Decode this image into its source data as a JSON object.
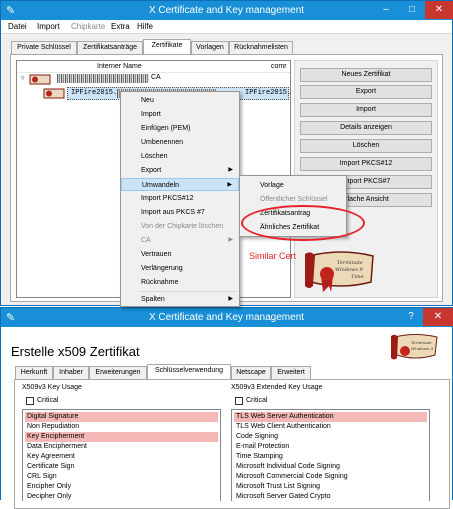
{
  "top_window": {
    "title": "X Certificate and Key management",
    "controls": [
      "–",
      "□",
      "✕"
    ],
    "menu": [
      "Datei",
      "Import",
      "Chipkarte",
      "Extra",
      "Hilfe"
    ],
    "tabs": [
      "Private Schlüssel",
      "Zertifikatsanträge",
      "Zertifikate",
      "Vorlagen",
      "Rücknahmelisten"
    ],
    "columns": [
      "Interner Name",
      "comr"
    ],
    "rows": [
      {
        "name": "CA",
        "extra": ""
      },
      {
        "name": "IPFire2015.",
        "extra": "IPFire2015."
      }
    ],
    "buttons": [
      "Neues Zertifikat",
      "Export",
      "Import",
      "Details anzeigen",
      "Löschen",
      "Import PKCS#12",
      "Import PKCS#7",
      "Flache Ansicht"
    ],
    "context_menu": [
      "Neu",
      "Import",
      "Einfügen (PEM)",
      "Umbenennen",
      "Löschen",
      "Export",
      "Umwandeln",
      "Import PKCS#12",
      "Import aus PKCS #7",
      "Von der Chipkarte löschen",
      "CA",
      "Vertrauen",
      "Verlängerung",
      "Rücknahme",
      "Spalten"
    ],
    "submenu": [
      "Vorlage",
      "Öffentlicher Schlüssel",
      "Zertifikatsantrag",
      "Ähnliches Zertifikat"
    ],
    "annotation": "Similar Cert",
    "logo_text": "Terminate Windows 9 Time"
  },
  "bottom_window": {
    "title": "X Certificate and Key management",
    "controls": [
      "?",
      "✕"
    ],
    "heading": "Erstelle x509 Zertifikat",
    "tabs": [
      "Herkunft",
      "Inhaber",
      "Erweiterungen",
      "Schlüsselverwendung",
      "Netscape",
      "Erweitert"
    ],
    "key_usage": {
      "title": "X509v3 Key Usage",
      "critical_label": "Critical",
      "items": [
        {
          "label": "Digital Signature",
          "selected": true
        },
        {
          "label": "Non Repudiation",
          "selected": false
        },
        {
          "label": "Key Encipherment",
          "selected": true
        },
        {
          "label": "Data Encipherment",
          "selected": false
        },
        {
          "label": "Key Agreement",
          "selected": false
        },
        {
          "label": "Certificate Sign",
          "selected": false
        },
        {
          "label": "CRL Sign",
          "selected": false
        },
        {
          "label": "Encipher Only",
          "selected": false
        },
        {
          "label": "Decipher Only",
          "selected": false
        }
      ]
    },
    "ext_key_usage": {
      "title": "X509v3 Extended Key Usage",
      "critical_label": "Critical",
      "items": [
        {
          "label": "TLS Web Server Authentication",
          "selected": true
        },
        {
          "label": "TLS Web Client Authentication",
          "selected": false
        },
        {
          "label": "Code Signing",
          "selected": false
        },
        {
          "label": "E-mail Protection",
          "selected": false
        },
        {
          "label": "Time Stamping",
          "selected": false
        },
        {
          "label": "Microsoft Individual Code Signing",
          "selected": false
        },
        {
          "label": "Microsoft Commercial Code Signing",
          "selected": false
        },
        {
          "label": "Microsoft Trust List Signing",
          "selected": false
        },
        {
          "label": "Microsoft Server Gated Crypto",
          "selected": false
        }
      ]
    }
  },
  "colors": {
    "titlebar": "#188fd6",
    "selection": "#f4b8b6",
    "annotation": "#e8222a",
    "menu_highlight": "#cce4f7"
  }
}
